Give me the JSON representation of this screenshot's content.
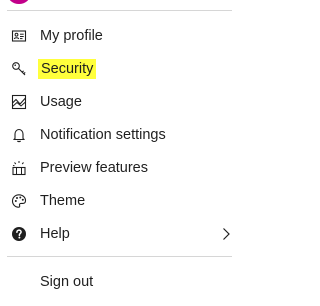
{
  "menu": {
    "items": [
      {
        "label": "My profile",
        "icon": "contact-card-icon"
      },
      {
        "label": "Security",
        "icon": "key-icon",
        "highlighted": true,
        "highlight_color": "#ffff3c"
      },
      {
        "label": "Usage",
        "icon": "usage-chart-icon"
      },
      {
        "label": "Notification settings",
        "icon": "bell-icon"
      },
      {
        "label": "Preview features",
        "icon": "preview-features-icon"
      },
      {
        "label": "Theme",
        "icon": "palette-icon"
      },
      {
        "label": "Help",
        "icon": "help-circle-icon",
        "has_submenu": true
      }
    ],
    "sign_out": {
      "label": "Sign out"
    }
  },
  "colors": {
    "avatar": "#c2008a",
    "divider": "#d6d6d6",
    "text": "#1f1f1f"
  }
}
